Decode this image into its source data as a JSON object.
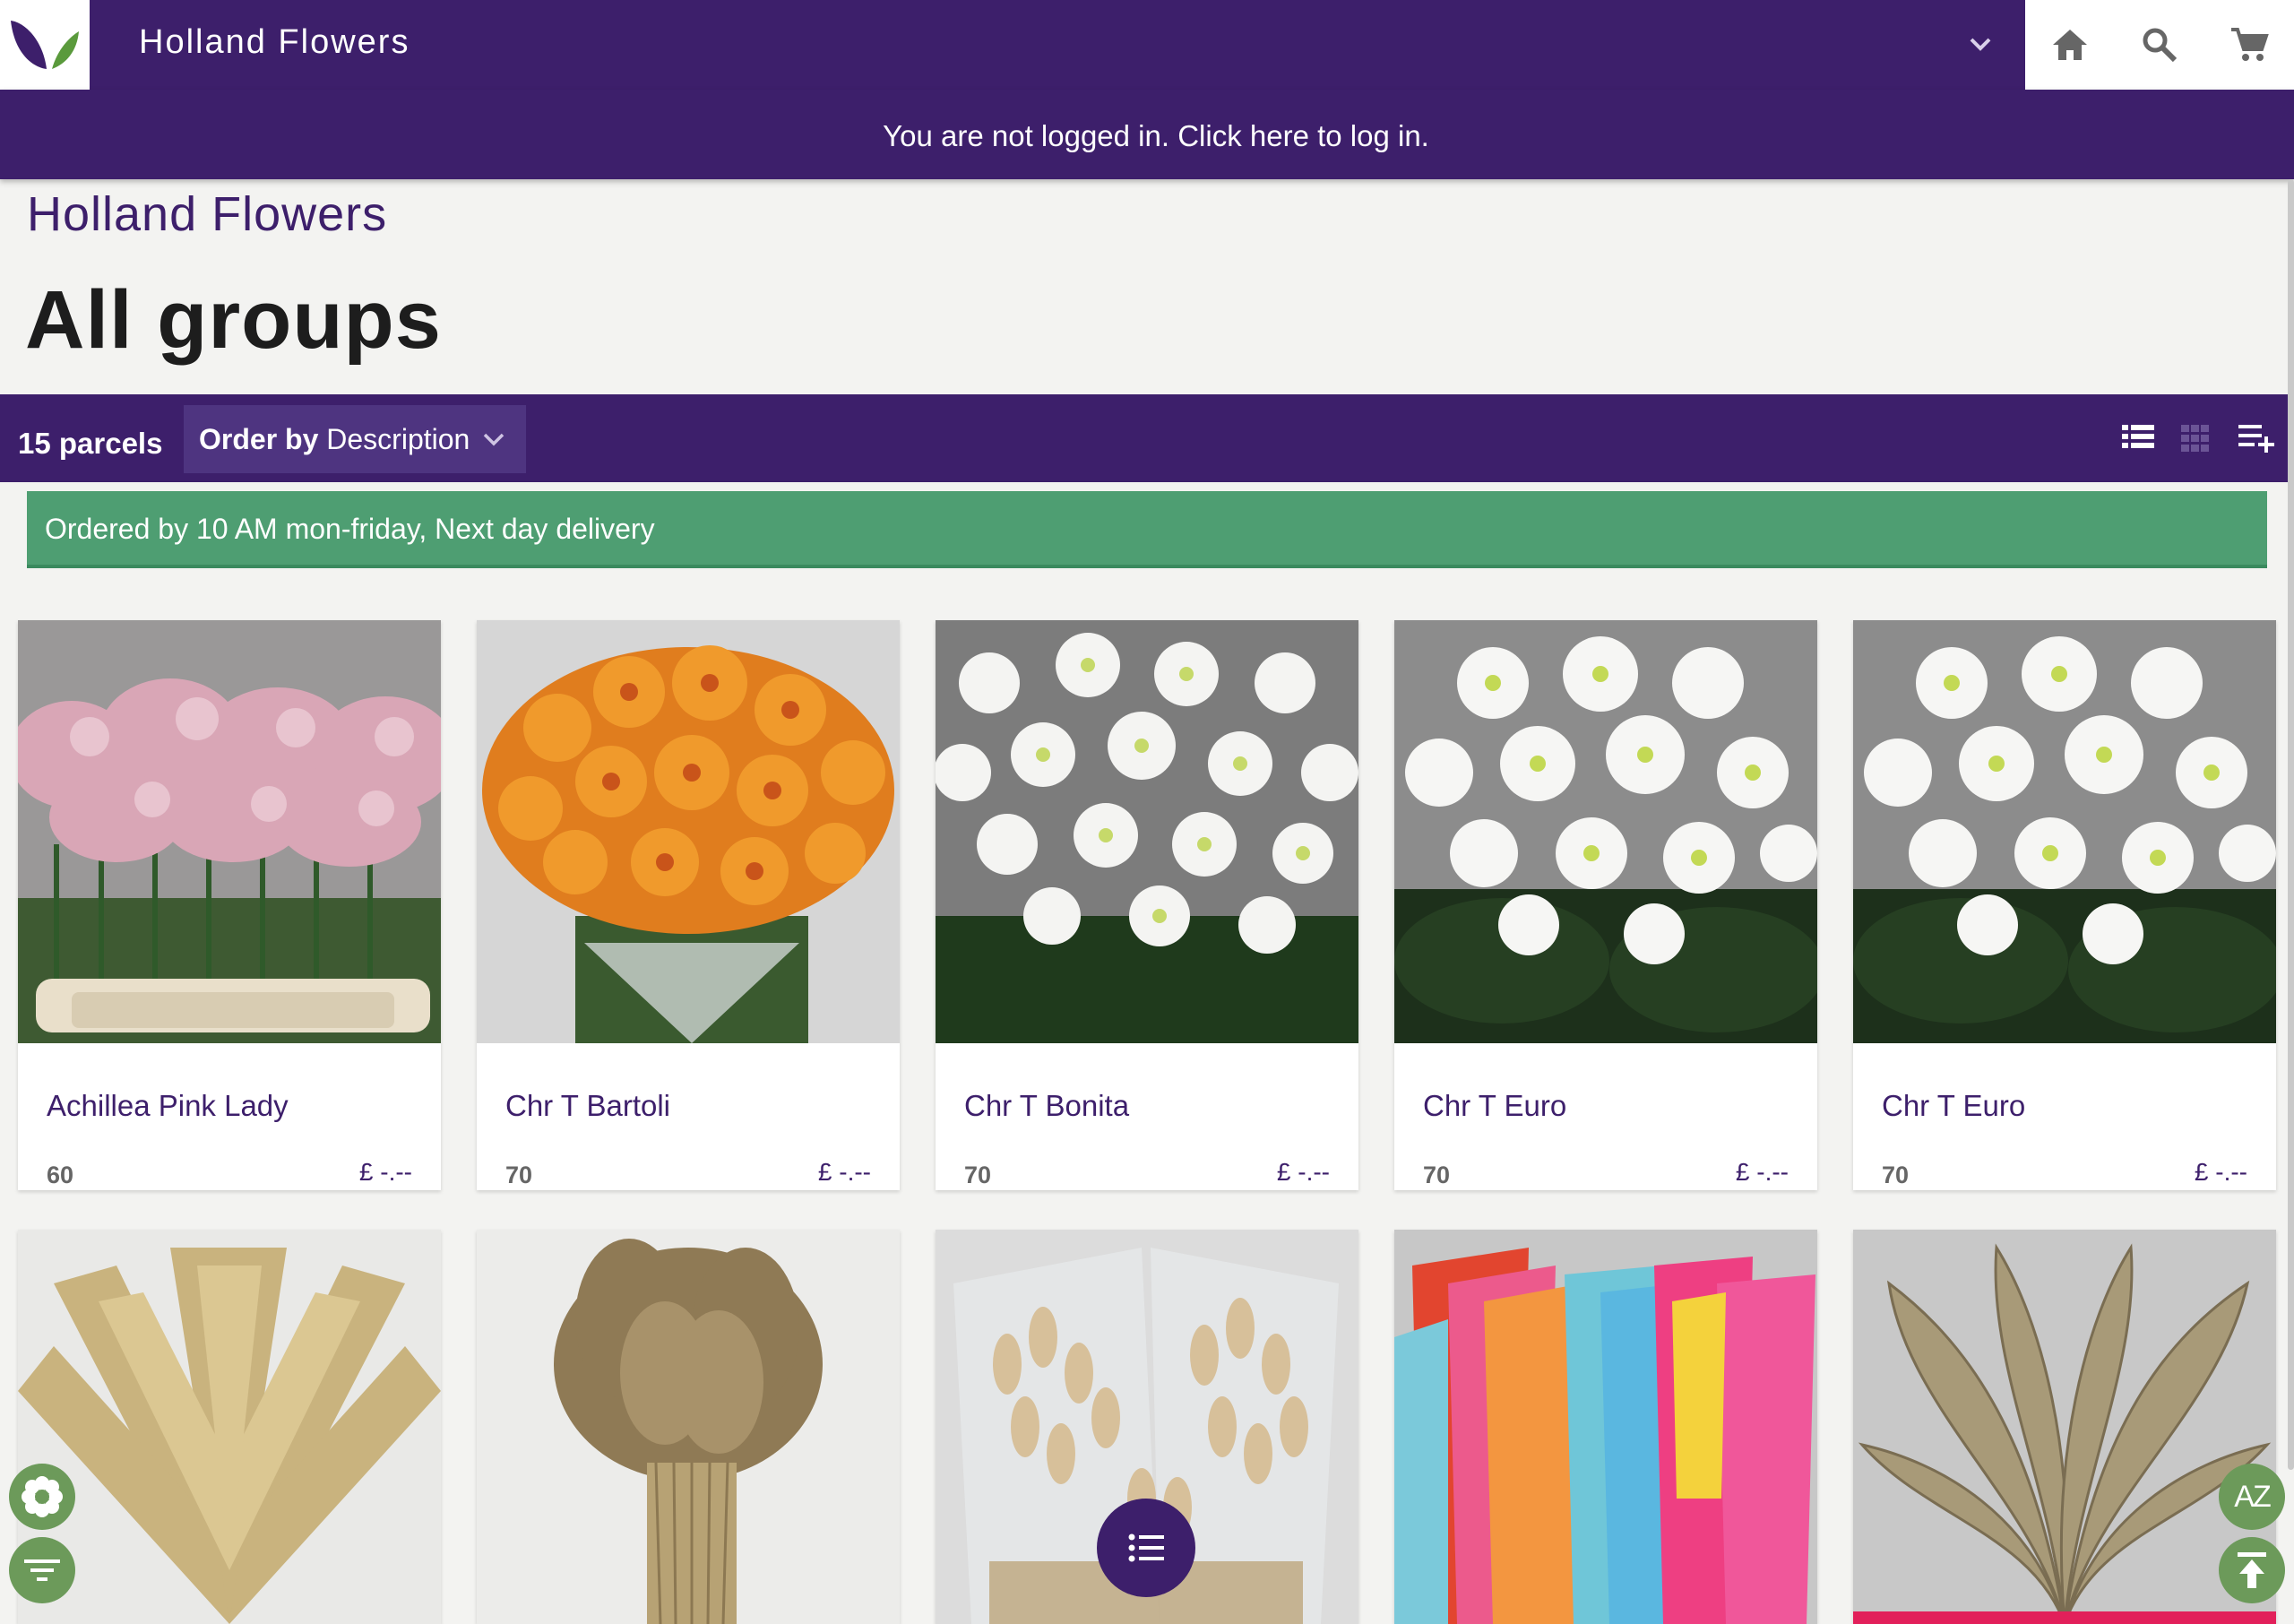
{
  "header": {
    "app_title": "Holland Flowers",
    "icons": [
      "logo-icon",
      "chevron-down-icon",
      "home-icon",
      "search-icon",
      "cart-icon"
    ]
  },
  "login_banner": {
    "text": "You are not logged in. Click here to log in."
  },
  "breadcrumb": "Holland Flowers",
  "page_title": "All groups",
  "toolbar": {
    "parcel_count": "15 parcels",
    "order_by_label": "Order by",
    "order_by_value": "Description",
    "view_icons": [
      "list-view-icon",
      "grid-view-icon",
      "add-to-list-icon"
    ]
  },
  "delivery_notice": "Ordered by 10 AM mon-friday, Next day delivery",
  "products": [
    {
      "name": "Achillea Pink Lady",
      "qty": "60",
      "price": "£ -.--"
    },
    {
      "name": "Chr T Bartoli",
      "qty": "70",
      "price": "£ -.--"
    },
    {
      "name": "Chr T Bonita",
      "qty": "70",
      "price": "£ -.--"
    },
    {
      "name": "Chr T Euro",
      "qty": "70",
      "price": "£ -.--"
    },
    {
      "name": "Chr T Euro",
      "qty": "70",
      "price": "£ -.--"
    }
  ],
  "products_row2_images": [
    "pampas-grass-image",
    "dried-grass-image",
    "bunny-tail-grass-image",
    "colored-ruscus-image",
    "dried-leaves-image"
  ],
  "floating_buttons": {
    "az_label": "AZ",
    "icons": [
      "flower-icon",
      "filter-icon",
      "list-icon",
      "sort-az-icon",
      "scroll-top-icon"
    ]
  },
  "colors": {
    "brand": "#3d1f6b",
    "notice": "#4e9e72",
    "accent": "#e2205a",
    "fab": "#6c9a5a"
  }
}
